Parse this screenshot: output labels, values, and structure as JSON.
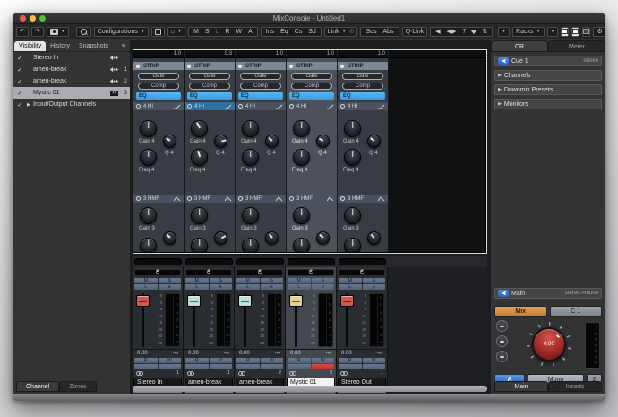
{
  "window": {
    "title": "MixConsole - Untitled1"
  },
  "toolbar": {
    "configurations": "Configurations",
    "channel_states": [
      {
        "label": "M"
      },
      {
        "label": "S"
      },
      {
        "label": "L",
        "dim": true
      },
      {
        "label": "R"
      },
      {
        "label": "W"
      },
      {
        "label": "A"
      }
    ],
    "rack_toggles": [
      {
        "label": "Ins"
      },
      {
        "label": "Eq"
      },
      {
        "label": "Cs"
      },
      {
        "label": "Sd"
      }
    ],
    "link": "Link",
    "sus": "Sus",
    "abs": "Abs",
    "qlink": "Q-Link",
    "link_group_count": "7",
    "racks": "Racks"
  },
  "icons": {
    "undo": "↶",
    "redo": "↷",
    "dropdown": "▼",
    "home": "⌂",
    "gear": "⚙",
    "slash": "⊘",
    "prev": "◀",
    "arrows_lr": "◀▶",
    "spinner": "⇅",
    "menu": "≡",
    "expand": "▶"
  },
  "left_panel": {
    "tabs": [
      {
        "label": "Visibility",
        "active": true
      },
      {
        "label": "History"
      },
      {
        "label": "Snapshots"
      }
    ],
    "rows": [
      {
        "check": "✓",
        "name": "Stereo In",
        "audio": true,
        "num": ""
      },
      {
        "check": "✓",
        "name": "amen-break",
        "audio": true,
        "num": "1"
      },
      {
        "check": "✓",
        "name": "amen-break",
        "audio": true,
        "num": "2"
      },
      {
        "check": "✓",
        "name": "Mystic 01",
        "piano": true,
        "num": "3",
        "selected": true
      },
      {
        "check": "✓",
        "name": "Input/Output Channels",
        "expandable": true,
        "num": ""
      }
    ],
    "bottom_tabs": [
      {
        "label": "Channel",
        "active": true
      },
      {
        "label": "Zones"
      }
    ]
  },
  "racks": {
    "strip": "STRIP",
    "gate": "Gate",
    "comp": "Comp",
    "eq": "EQ",
    "band_hi": "4 HI",
    "band_hmf": "3 HMF",
    "gain4": "Gain 4",
    "q4": "Q 4",
    "freq4": "Freq 4",
    "gain3": "Gain 3",
    "strips": [
      {
        "width_value": "1.0",
        "gain4_rot": "0deg",
        "q4_rot": "-55deg",
        "freq4_rot": "0deg",
        "gain3_rot": "0deg",
        "q3_rot": "-45deg"
      },
      {
        "width_value": "0.3",
        "hi_active": true,
        "gain4_rot": "-28deg",
        "q4_rot": "75deg",
        "freq4_rot": "-18deg",
        "gain3_rot": "0deg",
        "q3_rot": "60deg"
      },
      {
        "width_value": "1.0",
        "gain4_rot": "0deg",
        "q4_rot": "-50deg",
        "freq4_rot": "0deg",
        "gain3_rot": "0deg",
        "q3_rot": "-40deg"
      },
      {
        "width_value": "1.0",
        "selected": true,
        "gain4_rot": "0deg",
        "q4_rot": "-60deg",
        "freq4_rot": "0deg",
        "gain3_rot": "0deg",
        "q3_rot": "-50deg"
      },
      {
        "width_value": "1.0",
        "gain4_rot": "0deg",
        "q4_rot": "-55deg",
        "freq4_rot": "0deg",
        "gain3_rot": "0deg",
        "q3_rot": "-45deg"
      }
    ]
  },
  "faders": {
    "pan": "C",
    "m": "M",
    "s": "S",
    "l": "L",
    "e": "e",
    "r": "R",
    "w": "W",
    "fader_scale": [
      "6",
      "0",
      "6",
      "10",
      "15",
      "20",
      "30",
      "60"
    ],
    "meter_scale": [
      "6",
      "12",
      "18",
      "24",
      "30",
      "40",
      "60"
    ],
    "value": "0.00",
    "meter_value": "-∞",
    "channels": [
      {
        "name": "Stereo In",
        "num": "1",
        "cap": "#cf5751"
      },
      {
        "name": "amen-break",
        "num": "1",
        "cap": "#bcdfd9"
      },
      {
        "name": "amen-break",
        "num": "2",
        "cap": "#bcdfd9"
      },
      {
        "name": "Mystic 01",
        "num": "3",
        "cap": "#e0d394",
        "selected": true,
        "record_active": true
      },
      {
        "name": "Stereo Out",
        "num": "1",
        "cap": "#cf5751"
      }
    ]
  },
  "right_panel": {
    "tabs": [
      {
        "label": "CR",
        "active": true
      },
      {
        "label": "Meter"
      }
    ],
    "cue": {
      "label": "Cue 1",
      "mode": "stereo"
    },
    "sections": [
      {
        "label": "Channels"
      },
      {
        "label": "Downmix Presets"
      },
      {
        "label": "Monitors"
      }
    ],
    "main_row": {
      "label": "Main",
      "mode": "stereo->mono"
    },
    "mix": "Mix",
    "c1": "C 1",
    "knob_value": "0.00",
    "a": "A",
    "mono": "Mono",
    "two": "2",
    "bottom_tabs": [
      {
        "label": "Main",
        "active": true
      },
      {
        "label": "Inserts"
      }
    ]
  },
  "colors": {
    "accent_blue": "#379ade",
    "selected_strip": "#4d525a",
    "record_red": "#c9332d",
    "mix_orange": "#d8924a",
    "monitor_a_blue": "#3f7fd1",
    "cap_red": "#cf5751",
    "cap_cyan": "#bcdfd9",
    "cap_yellow": "#e0d394"
  }
}
